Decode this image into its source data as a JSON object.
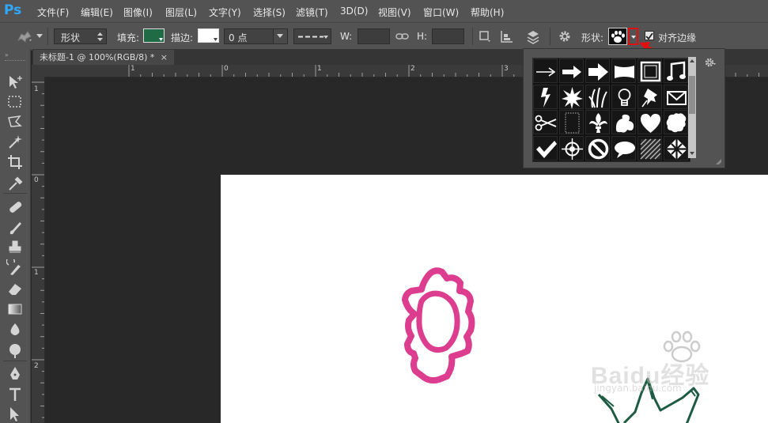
{
  "app": {
    "logo": "Ps"
  },
  "menu": [
    "文件(F)",
    "编辑(E)",
    "图像(I)",
    "图层(L)",
    "文字(Y)",
    "选择(S)",
    "滤镜(T)",
    "3D(D)",
    "视图(V)",
    "窗口(W)",
    "帮助(H)"
  ],
  "options": {
    "mode_value": "形状",
    "fill_label": "填充:",
    "fill_color": "#1f6b45",
    "stroke_label": "描边:",
    "stroke_color": "#ffffff",
    "stroke_width_value": "0 点",
    "w_label": "W:",
    "h_label": "H:",
    "shape_label": "形状:",
    "align_edges_label": "对齐边缘",
    "align_edges_checked": true
  },
  "document": {
    "tab_title": "未标题-1 @ 100%(RGB/8) *",
    "close": "×"
  },
  "rulers": {
    "horizontal": [
      "1",
      "0",
      "1",
      "2",
      "3"
    ],
    "vertical": [
      "1",
      "0",
      "1",
      "2"
    ]
  },
  "shape_picker": {
    "shapes": [
      "arrow-thin-icon",
      "arrow-medium-icon",
      "arrow-bold-icon",
      "banner-icon",
      "frame-icon",
      "music-note-icon",
      "lightning-icon",
      "starburst-icon",
      "grass-icon",
      "light-bulb-icon",
      "thumbtack-icon",
      "envelope-icon",
      "scissors-icon",
      "stamp-frame-icon",
      "fleur-de-lis-icon",
      "ornament-icon",
      "heart-icon",
      "puzzle-icon",
      "checkmark-icon",
      "target-icon",
      "no-sign-icon",
      "speech-bubble-icon",
      "diagonal-lines-icon",
      "checkerboard-icon"
    ]
  },
  "watermark": {
    "text": "Baidu经验",
    "url": "jingyan.baidu.com"
  },
  "colors": {
    "drawing_pink": "#dc3d8e",
    "drawing_green": "#1d5c42",
    "callout_red": "#e01010"
  }
}
